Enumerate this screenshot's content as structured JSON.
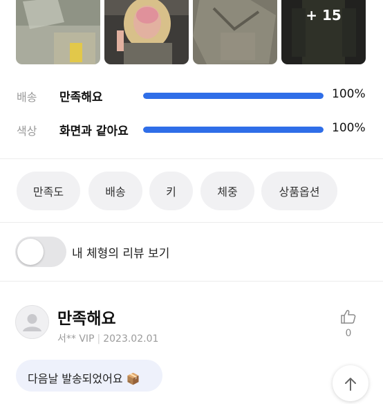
{
  "photos": {
    "items": [
      {
        "name": "review-photo-1"
      },
      {
        "name": "review-photo-2"
      },
      {
        "name": "review-photo-3"
      },
      {
        "name": "review-photo-4"
      }
    ],
    "more_label": "+ 15"
  },
  "ratings": [
    {
      "category": "배송",
      "value": "만족해요",
      "percent_text": "100%",
      "percent": 100
    },
    {
      "category": "색상",
      "value": "화면과 같아요",
      "percent_text": "100%",
      "percent": 100
    }
  ],
  "filters": {
    "chips": [
      "만족도",
      "배송",
      "키",
      "체중",
      "상품옵션"
    ]
  },
  "my_review_toggle": {
    "label": "내 체형의 리뷰 보기",
    "checked": false
  },
  "review": {
    "title": "만족해요",
    "author": "서**",
    "grade": "VIP",
    "date": "2023.02.01",
    "likes": "0",
    "tag": "다음날 발송되었어요",
    "tag_emoji": "📦"
  },
  "colors": {
    "accent": "#2f6ee8",
    "bar_track": "#e7e9ee",
    "chip_bg": "#f1f1f3",
    "tag_bg": "#eef1fb"
  }
}
